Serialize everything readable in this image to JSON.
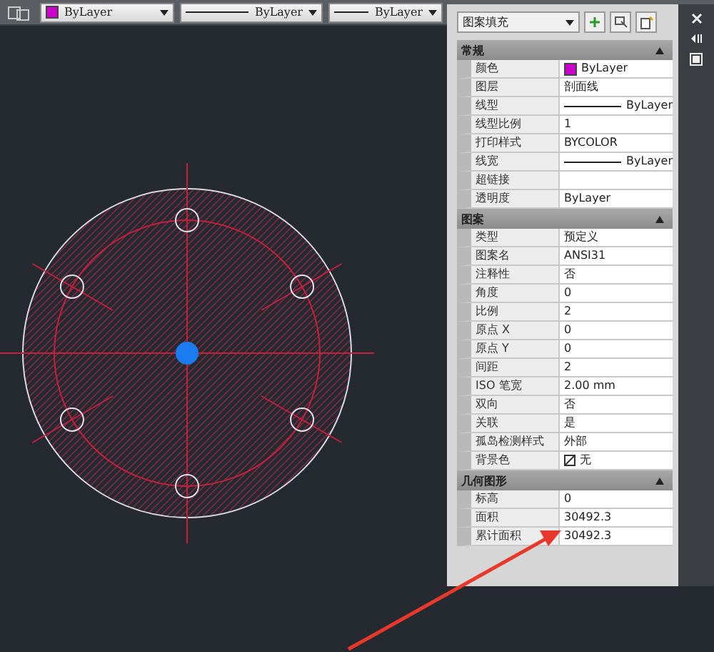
{
  "toolbar": {
    "color_dropdown": {
      "label": "ByLayer",
      "color": "#cc00cc"
    },
    "linetype_dropdown": {
      "label": "ByLayer"
    },
    "lineweight_dropdown": {
      "label": "ByLayer"
    }
  },
  "properties": {
    "object_type": "图案填充",
    "sections": [
      {
        "title": "常规",
        "expanded": true,
        "rows": [
          {
            "name": "颜色",
            "value": "ByLayer",
            "kind": "color",
            "color": "#cc00cc"
          },
          {
            "name": "图层",
            "value": "剖面线",
            "kind": "text"
          },
          {
            "name": "线型",
            "value": "ByLayer",
            "kind": "line"
          },
          {
            "name": "线型比例",
            "value": "1",
            "kind": "text"
          },
          {
            "name": "打印样式",
            "value": "BYCOLOR",
            "kind": "text"
          },
          {
            "name": "线宽",
            "value": "ByLayer",
            "kind": "line"
          },
          {
            "name": "超链接",
            "value": "",
            "kind": "text"
          },
          {
            "name": "透明度",
            "value": "ByLayer",
            "kind": "text"
          }
        ]
      },
      {
        "title": "图案",
        "expanded": true,
        "rows": [
          {
            "name": "类型",
            "value": "预定义",
            "kind": "text"
          },
          {
            "name": "图案名",
            "value": "ANSI31",
            "kind": "text"
          },
          {
            "name": "注释性",
            "value": "否",
            "kind": "text"
          },
          {
            "name": "角度",
            "value": "0",
            "kind": "text"
          },
          {
            "name": "比例",
            "value": "2",
            "kind": "text"
          },
          {
            "name": "原点 X",
            "value": "0",
            "kind": "text"
          },
          {
            "name": "原点 Y",
            "value": "0",
            "kind": "text"
          },
          {
            "name": "间距",
            "value": "2",
            "kind": "text"
          },
          {
            "name": "ISO 笔宽",
            "value": "2.00 mm",
            "kind": "text"
          },
          {
            "name": "双向",
            "value": "否",
            "kind": "text"
          },
          {
            "name": "关联",
            "value": "是",
            "kind": "text"
          },
          {
            "name": "孤岛检测样式",
            "value": "外部",
            "kind": "text"
          },
          {
            "name": "背景色",
            "value": "无",
            "kind": "nocolor"
          }
        ]
      },
      {
        "title": "几何图形",
        "expanded": true,
        "rows": [
          {
            "name": "标高",
            "value": "0",
            "kind": "text"
          },
          {
            "name": "面积",
            "value": "30492.3",
            "kind": "text"
          },
          {
            "name": "累计面积",
            "value": "30492.3",
            "kind": "text"
          }
        ]
      }
    ]
  }
}
